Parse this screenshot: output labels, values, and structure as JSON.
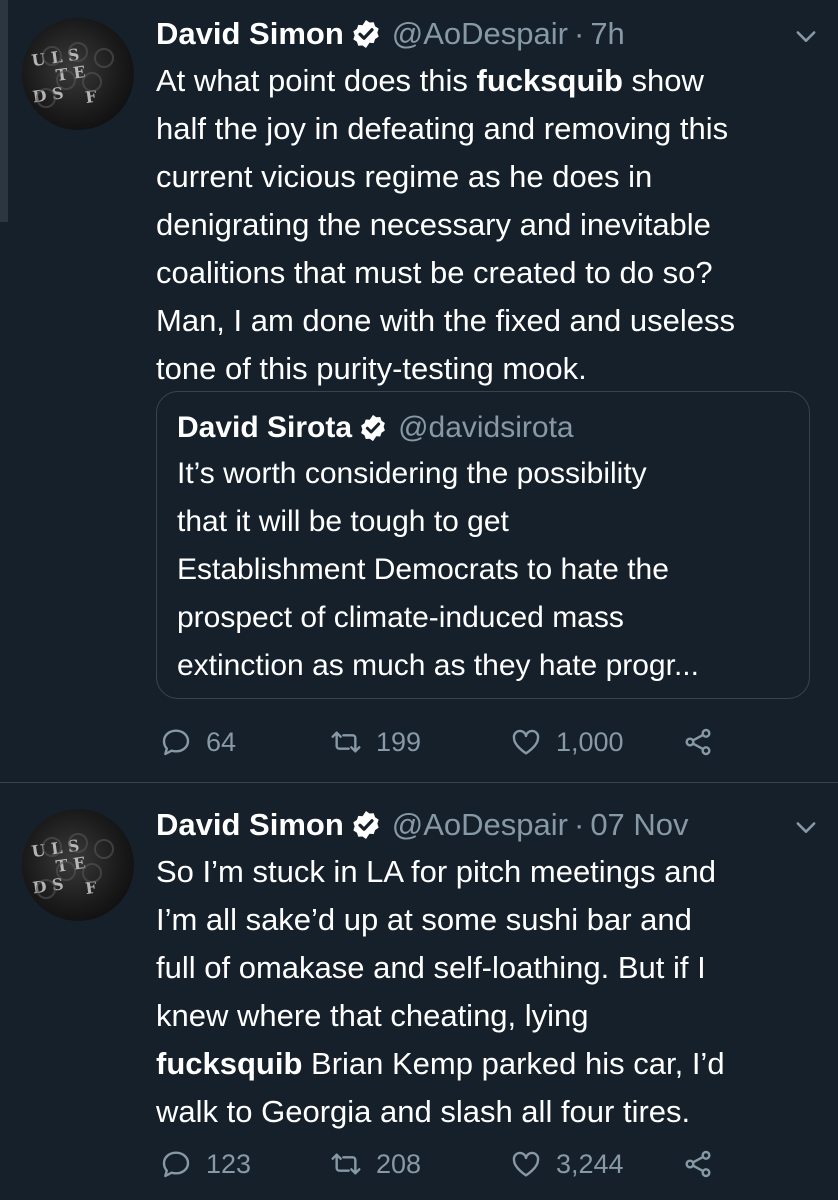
{
  "tweets": [
    {
      "name": "David Simon",
      "handle": "@AoDespair",
      "separator": "·",
      "time": "7h",
      "text_segments": [
        {
          "text": "At what point does this ",
          "bold": false
        },
        {
          "text": "fucksquib",
          "bold": true
        },
        {
          "text": " show\nhalf the joy in defeating and removing this\ncurrent vicious regime as he does in\ndenigrating the necessary and inevitable\ncoalitions that must be created to do so?\nMan, I am done with the fixed and useless\ntone of this purity-testing mook.",
          "bold": false
        }
      ],
      "quote": {
        "name": "David Sirota",
        "handle": "@davidsirota",
        "text": "It’s worth considering the possibility\nthat it will be tough to get\nEstablishment Democrats to hate the\nprospect of climate-induced mass\nextinction as much as they hate progr..."
      },
      "replies": "64",
      "retweets": "199",
      "likes": "1,000"
    },
    {
      "name": "David Simon",
      "handle": "@AoDespair",
      "separator": "·",
      "time": "07 Nov",
      "text_segments": [
        {
          "text": "So I’m stuck in LA for pitch meetings and\nI’m all sake’d up at some sushi bar and\nfull of omakase and self-loathing. But if I\nknew where that cheating, lying\n",
          "bold": false
        },
        {
          "text": "fucksquib",
          "bold": true
        },
        {
          "text": " Brian Kemp parked his car, I’d\nwalk to Georgia and slash all four tires.",
          "bold": false
        }
      ],
      "replies": "123",
      "retweets": "208",
      "likes": "3,244"
    }
  ],
  "colors": {
    "background": "#15202b",
    "secondary_text": "#8899a6",
    "divider": "#38444d",
    "verified_badge": "#ffffff"
  },
  "icons": [
    "verified-badge-icon",
    "chevron-down-icon",
    "reply-icon",
    "retweet-icon",
    "like-icon",
    "share-icon"
  ]
}
